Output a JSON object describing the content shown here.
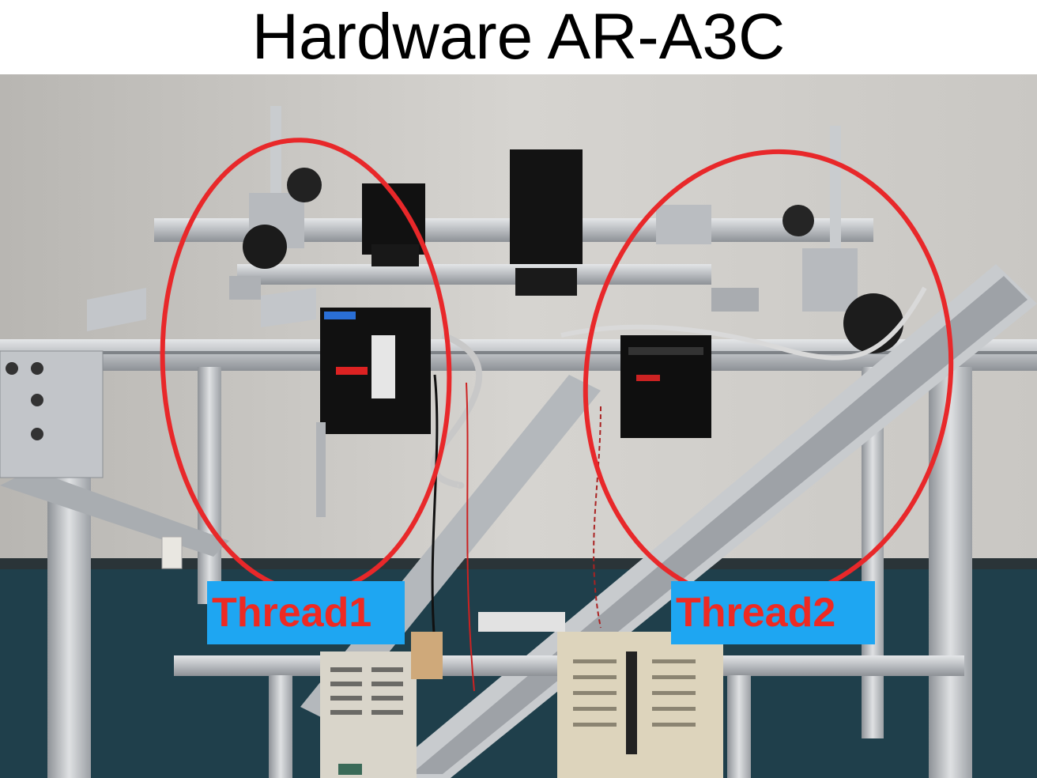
{
  "slide": {
    "title": "Hardware AR-A3C"
  },
  "labels": {
    "thread1": "Thread1",
    "thread2": "Thread2"
  },
  "colors": {
    "highlight_circle": "#e8282a",
    "label_background": "#1ea6f2",
    "label_text": "#ee2a23"
  }
}
